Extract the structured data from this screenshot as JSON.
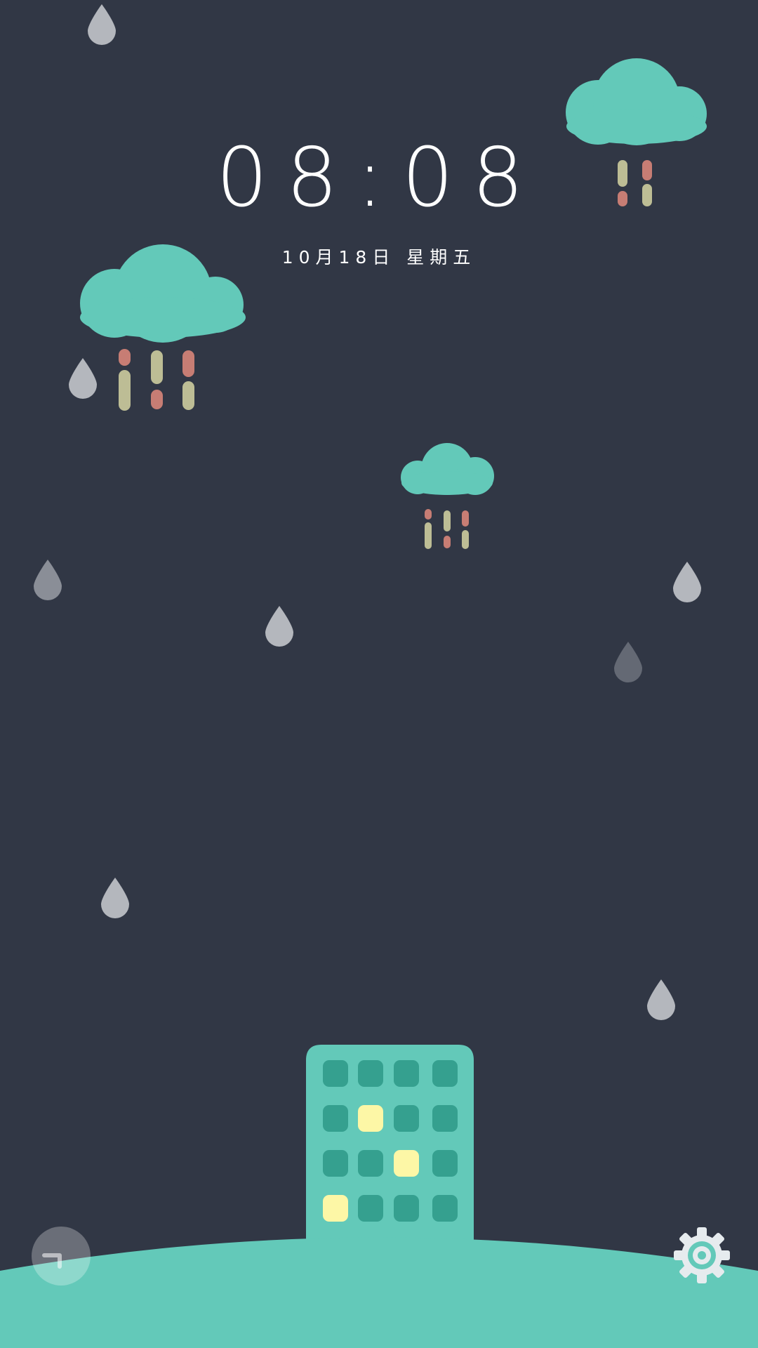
{
  "lockscreen": {
    "time": "08:08",
    "date": "10月18日  星期五"
  },
  "colors": {
    "background": "#313745",
    "teal": "#63C9B9",
    "window_dark": "#35A08F",
    "window_lit": "#FDF7A6",
    "rain_red": "#C77D74",
    "rain_olive": "#BDBD95",
    "drop": "#B4B7BD"
  },
  "icons": {
    "left_button": "corner-icon",
    "right_button": "gear-icon"
  }
}
